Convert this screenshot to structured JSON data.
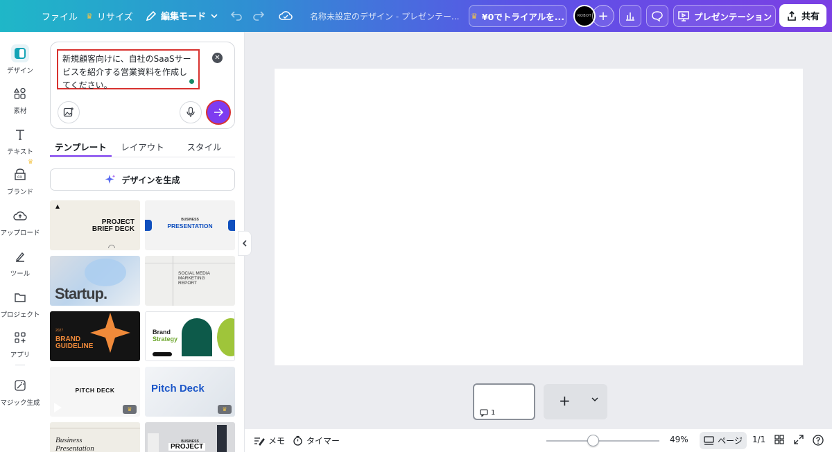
{
  "topbar": {
    "file": "ファイル",
    "resize": "リサイズ",
    "edit_mode": "編集モード",
    "doc_title": "名称未設定のデザイン - プレゼンテー...",
    "trial": "¥0でトライアルを...",
    "avatar_text": "ROBOT",
    "present": "プレゼンテーション",
    "share": "共有"
  },
  "rail": [
    {
      "label": "デザイン",
      "icon": "design-icon"
    },
    {
      "label": "素材",
      "icon": "elements-icon"
    },
    {
      "label": "テキスト",
      "icon": "text-icon"
    },
    {
      "label": "ブランド",
      "icon": "brand-icon"
    },
    {
      "label": "アップロード",
      "icon": "upload-icon"
    },
    {
      "label": "ツール",
      "icon": "tools-icon"
    },
    {
      "label": "プロジェクト",
      "icon": "folder-icon"
    },
    {
      "label": "アプリ",
      "icon": "apps-icon"
    },
    {
      "label": "マジック生成",
      "icon": "magic-icon"
    }
  ],
  "prompt": {
    "text": "新規顧客向けに、自社のSaaSサービスを紹介する営業資料を作成してください。"
  },
  "tabs": [
    "テンプレート",
    "レイアウト",
    "スタイル"
  ],
  "generate_label": "デザインを生成",
  "templates": {
    "t1": {
      "title": "PROJECT\nBRIEF DECK"
    },
    "t2": {
      "small": "BUSINESS",
      "title": "PRESENTATION"
    },
    "t3": {
      "title": "Startup."
    },
    "t4": {
      "title": "SOCIAL MEDIA\nMARKETING\nREPORT"
    },
    "t5": {
      "small": "2027",
      "title": "BRAND\nGUIDELINE"
    },
    "t6": {
      "title": "Brand",
      "title2": "Strategy"
    },
    "t7": {
      "title": "PITCH DECK"
    },
    "t8": {
      "title": "Pitch Deck"
    },
    "t9": {
      "title": "Business\nPresentation"
    },
    "t10": {
      "small": "BUSINESS",
      "title": "PROJECT"
    }
  },
  "page_thumb": {
    "number": "1"
  },
  "bottombar": {
    "notes": "メモ",
    "timer": "タイマー",
    "zoom": "49%",
    "zoom_level": 0.49,
    "page_label": "ページ",
    "page_count": "1/1"
  },
  "colors": {
    "accent": "#7d3cf0",
    "highlight": "#d8322f"
  }
}
